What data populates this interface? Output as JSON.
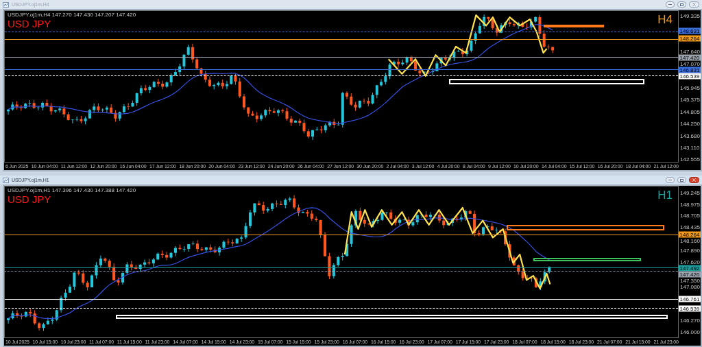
{
  "windows": [
    {
      "title": "USDJPY.oj1m,H4",
      "active": false,
      "info": "USDJPY.oj1m,H4  147.270 147.430 147.207 147.420",
      "symbol": "USD JPY",
      "timeframe": "H4",
      "color": "#f29a1a",
      "price_ticks": [
        "149.335",
        "147.640",
        "147.070",
        "145.945",
        "145.375",
        "144.805",
        "144.250",
        "143.680",
        "143.110",
        "142.555"
      ],
      "price_tags": [
        {
          "text": "148.631",
          "color": "#3b6fe0"
        },
        {
          "text": "148.264",
          "color": "#f29a1a"
        },
        {
          "text": "147.420",
          "color": "#9aa3ad"
        },
        {
          "text": "146.831",
          "color": "#3b6fe0"
        },
        {
          "text": "146.539",
          "color": "#ffffff"
        }
      ],
      "zones": [
        {
          "color": "#ff7a1a"
        },
        {
          "color": "#ffffff"
        }
      ],
      "time_labels": [
        "6 Jun 2025",
        "10 Jun 04:00",
        "11 Jun 12:00",
        "12 Jun 20:00",
        "16 Jun 04:00",
        "17 Jun 12:00",
        "18 Jun 20:00",
        "20 Jun 04:00",
        "23 Jun 12:00",
        "24 Jun 20:00",
        "26 Jun 04:00",
        "27 Jun 12:00",
        "30 Jun 20:00",
        "2 Jul 04:00",
        "3 Jul 12:00",
        "4 Jul 20:00",
        "8 Jul 04:00",
        "9 Jul 12:00",
        "10 Jul 20:00",
        "14 Jul 04:00",
        "15 Jul 12:00",
        "16 Jul 20:00",
        "18 Jul 04:00",
        "21 Jul 12:00"
      ]
    },
    {
      "title": "USDJPY.oj1m,H1",
      "active": true,
      "info": "USDJPY.oj1m,H1  147.396 147.430 147.388 147.420",
      "symbol": "USD JPY",
      "timeframe": "H1",
      "color": "#1aa3a3",
      "price_ticks": [
        "149.245",
        "148.975",
        "148.705",
        "148.435",
        "148.160",
        "147.890",
        "147.620",
        "147.350",
        "147.080",
        "146.270",
        "146.000"
      ],
      "price_tags": [
        {
          "text": "148.264",
          "color": "#f29a1a"
        },
        {
          "text": "147.492",
          "color": "#1a9a9a"
        },
        {
          "text": "147.420",
          "color": "#9aa3ad"
        },
        {
          "text": "146.761",
          "color": "#ffffff"
        },
        {
          "text": "146.539",
          "color": "#ffffff"
        }
      ],
      "zones": [
        {
          "color": "#ff7a1a"
        },
        {
          "color": "#3cc45a"
        },
        {
          "color": "#ffffff"
        }
      ],
      "time_labels": [
        "10 Jul 2025",
        "10 Jul 15:00",
        "10 Jul 23:00",
        "11 Jul 07:00",
        "11 Jul 15:00",
        "11 Jul 23:00",
        "14 Jul 07:00",
        "14 Jul 15:00",
        "14 Jul 23:00",
        "15 Jul 07:00",
        "15 Jul 15:00",
        "15 Jul 23:00",
        "16 Jul 07:00",
        "16 Jul 15:00",
        "16 Jul 23:00",
        "17 Jul 07:00",
        "17 Jul 15:00",
        "17 Jul 23:00",
        "18 Jul 07:00",
        "18 Jul 15:00",
        "18 Jul 23:00",
        "21 Jul 07:00",
        "21 Jul 15:00",
        "21 Jul 23:00"
      ]
    }
  ]
}
